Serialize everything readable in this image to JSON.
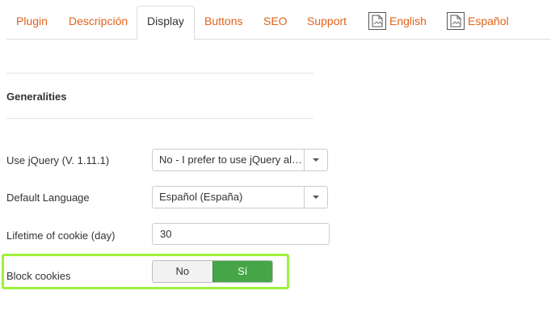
{
  "tabs": [
    {
      "label": "Plugin"
    },
    {
      "label": "Descripción"
    },
    {
      "label": "Display"
    },
    {
      "label": "Buttons"
    },
    {
      "label": "SEO"
    },
    {
      "label": "Support"
    },
    {
      "label": "English",
      "icon": "flag-image-icon"
    },
    {
      "label": "Español",
      "icon": "flag-image-icon"
    }
  ],
  "active_tab": "Display",
  "section": {
    "title": "Generalities"
  },
  "fields": {
    "jquery": {
      "label": "Use jQuery (V. 1.11.1)",
      "value": "No - I prefer to use jQuery already loaded"
    },
    "language": {
      "label": "Default Language",
      "value": "Español (España)"
    },
    "lifetime": {
      "label": "Lifetime of cookie (day)",
      "value": "30"
    },
    "block": {
      "label": "Block cookies",
      "options": [
        "No",
        "Sí"
      ],
      "selected": "Sí"
    }
  },
  "colors": {
    "accent": "#e0621d",
    "toggle_on": "#46a546",
    "highlight": "#9cf23a"
  }
}
